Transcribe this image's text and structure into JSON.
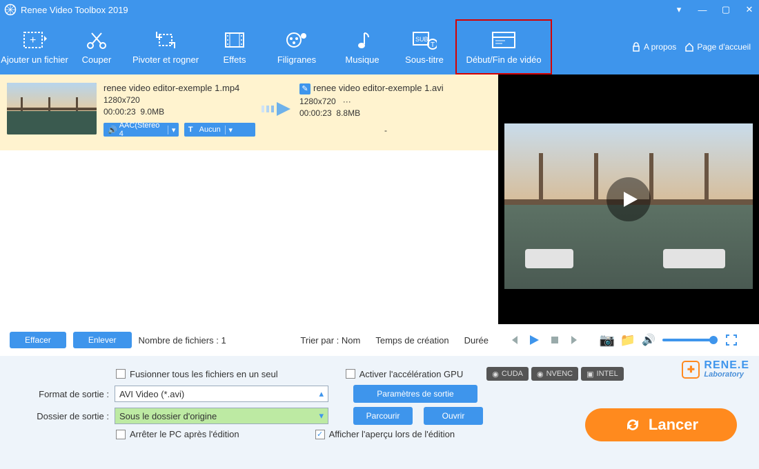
{
  "app": {
    "title": "Renee Video Toolbox 2019"
  },
  "window": {
    "drop": "▾",
    "min": "—",
    "max": "▢",
    "close": "✕"
  },
  "toolbar": {
    "items": [
      {
        "label": "Ajouter un fichier"
      },
      {
        "label": "Couper"
      },
      {
        "label": "Pivoter et rogner"
      },
      {
        "label": "Effets"
      },
      {
        "label": "Filigranes"
      },
      {
        "label": "Musique"
      },
      {
        "label": "Sous-titre"
      },
      {
        "label": "Début/Fin de vidéo"
      }
    ],
    "right": {
      "about": "A propos",
      "home": "Page d'accueil"
    }
  },
  "file": {
    "src": {
      "name": "renee video editor-exemple 1.mp4",
      "dim": "1280x720",
      "dur": "00:00:23",
      "size": "9.0MB",
      "audio_pill": "AAC(Stereo 4",
      "sub_pill": "Aucun"
    },
    "dst": {
      "name": "renee video editor-exemple 1.avi",
      "dim": "1280x720",
      "dim_extra": "···",
      "dur": "00:00:23",
      "size": "8.8MB",
      "placeholder": "-"
    }
  },
  "listbar": {
    "clear": "Effacer",
    "remove": "Enlever",
    "count_label": "Nombre de fichiers :",
    "count_value": "1",
    "sort_label": "Trier par :",
    "sort_name": "Nom",
    "sort_time": "Temps de création",
    "sort_dur": "Durée"
  },
  "bottom": {
    "merge_cb": "Fusionner tous les fichiers en un seul",
    "gpu_cb": "Activer l'accélération GPU",
    "badges": {
      "cuda": "CUDA",
      "nvenc": "NVENC",
      "intel": "INTEL"
    },
    "format_lbl": "Format de sortie :",
    "format_val": "AVI Video (*.avi)",
    "params_btn": "Paramètres de sortie",
    "folder_lbl": "Dossier de sortie :",
    "folder_val": "Sous le dossier d'origine",
    "browse_btn": "Parcourir",
    "open_btn": "Ouvrir",
    "shutdown_cb": "Arrêter le PC après l'édition",
    "preview_cb": "Afficher l'aperçu lors de l'édition",
    "launch": "Lancer",
    "brand1": "RENE.E",
    "brand2": "Laboratory"
  },
  "icons": {
    "speaker": "🔊",
    "camera": "📷",
    "folder": "📁",
    "t": "T",
    "pencil": "✎"
  }
}
